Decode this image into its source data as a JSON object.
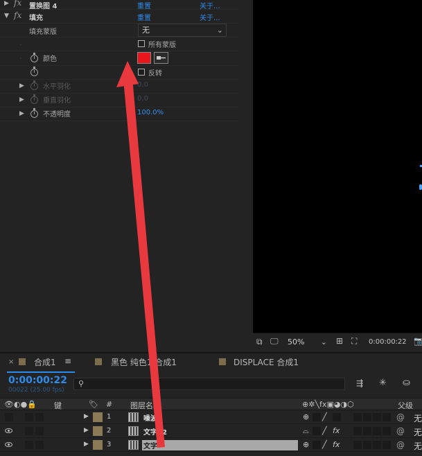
{
  "effects": {
    "top_effect": {
      "name": "置换图 4",
      "reset": "重置",
      "about": "关于..."
    },
    "fill_effect": {
      "name": "填充",
      "reset": "重置",
      "about": "关于..."
    },
    "fill_mask": {
      "label": "填充蒙版",
      "value": "无"
    },
    "all_masks": {
      "label": "所有蒙版"
    },
    "color": {
      "label": "颜色",
      "value_hex": "#e8161c"
    },
    "invert": {
      "label": "反转"
    },
    "h_feather": {
      "label": "水平羽化",
      "value": "0.0"
    },
    "v_feather": {
      "label": "垂直羽化",
      "value": "0.0"
    },
    "opacity": {
      "label": "不透明度",
      "value": "100.0%"
    }
  },
  "viewer": {
    "zoom": "50%",
    "timecode": "0:00:00:22"
  },
  "timeline": {
    "tabs": [
      {
        "label": "合成1",
        "active": true
      },
      {
        "label": "黑色 纯色1 合成1",
        "active": false
      },
      {
        "label": "DISPLACE 合成1",
        "active": false
      }
    ],
    "current_time": "0:00:00:22",
    "frame_info": "00022 (25.00 fps)",
    "columns": {
      "key": "键",
      "number": "#",
      "layer_name": "图层名称",
      "parent": "父级"
    },
    "layers": [
      {
        "num": "1",
        "name": "噪波",
        "visible": false,
        "parent": "无",
        "fx": false
      },
      {
        "num": "2",
        "name": "文字02",
        "visible": true,
        "parent": "无",
        "fx": true
      },
      {
        "num": "3",
        "name": "文字",
        "visible": true,
        "parent": "无",
        "fx": true
      }
    ]
  },
  "colors": {
    "accent": "#2d8ceb",
    "annotation_arrow": "#e8393f",
    "label_swatch": "#8b7a55"
  }
}
